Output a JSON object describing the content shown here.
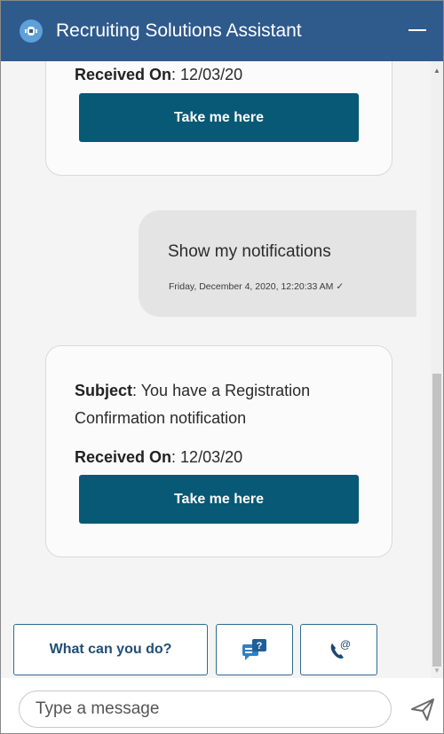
{
  "header": {
    "title": "Recruiting Solutions Assistant"
  },
  "messages": {
    "card1": {
      "received_label": "Received On",
      "received_value": ": 12/03/20",
      "button": "Take me here"
    },
    "user": {
      "text": "Show my notifications",
      "timestamp": "Friday, December 4, 2020, 12:20:33 AM ✓"
    },
    "card2": {
      "subject_label": "Subject",
      "subject_line1": ": You have a Registration",
      "subject_line2": "Confirmation notification",
      "received_label": "Received On",
      "received_value": ": 12/03/20",
      "button": "Take me here"
    }
  },
  "quick_replies": {
    "what_can_you_do": "What can you do?"
  },
  "input": {
    "placeholder": "Type a message"
  },
  "colors": {
    "header": "#2f5a8c",
    "button": "#075975",
    "accent": "#2f6b8f"
  }
}
